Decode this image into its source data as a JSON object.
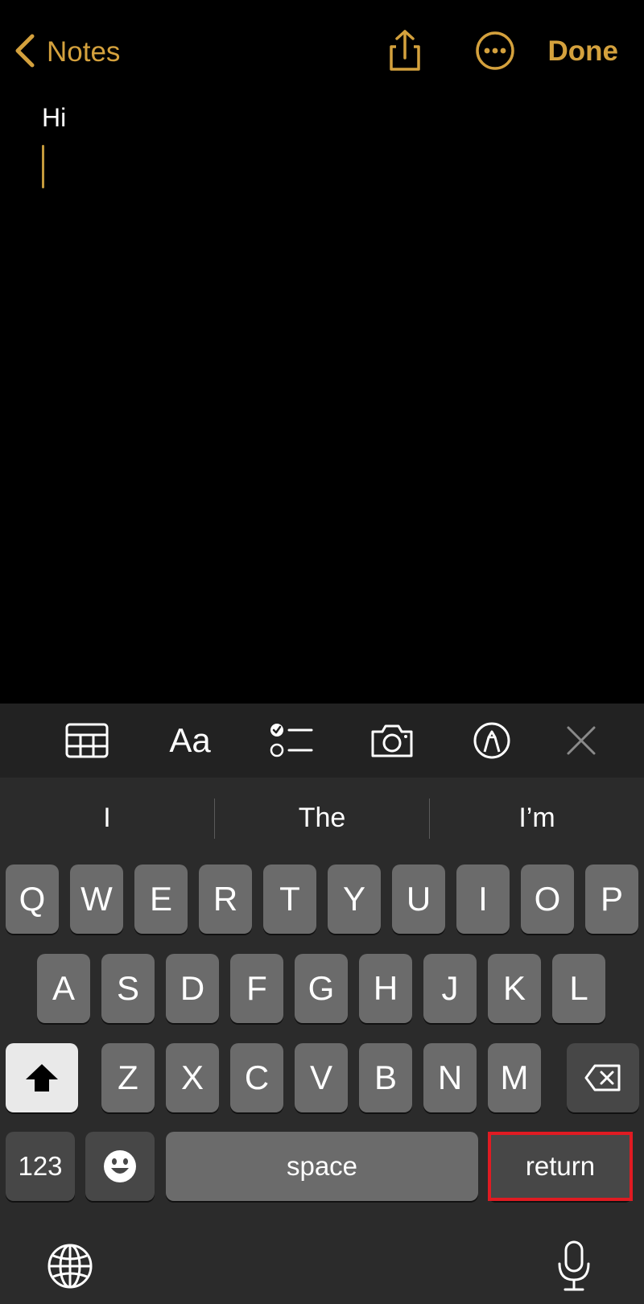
{
  "nav": {
    "back_label": "Notes",
    "done_label": "Done",
    "icons": [
      "chevron-left-icon",
      "share-icon",
      "ellipsis-circle-icon"
    ]
  },
  "note": {
    "text": "Hi"
  },
  "toolbar": {
    "format_label": "Aa",
    "icons": [
      "table-icon",
      "checklist-icon",
      "camera-icon",
      "markup-pen-icon",
      "close-icon"
    ]
  },
  "keyboard": {
    "suggestions": [
      "I",
      "The",
      "I’m"
    ],
    "row1": [
      "Q",
      "W",
      "E",
      "R",
      "T",
      "Y",
      "U",
      "I",
      "O",
      "P"
    ],
    "row2": [
      "A",
      "S",
      "D",
      "F",
      "G",
      "H",
      "J",
      "K",
      "L"
    ],
    "row3": [
      "Z",
      "X",
      "C",
      "V",
      "B",
      "N",
      "M"
    ],
    "numbers_label": "123",
    "space_label": "space",
    "return_label": "return",
    "icons": [
      "shift-icon",
      "backspace-icon",
      "emoji-icon",
      "globe-icon",
      "microphone-icon"
    ]
  },
  "colors": {
    "accent": "#d4a13d",
    "background": "#000000",
    "keyboard_bg": "#2b2b2b",
    "key_bg": "#6b6b6b",
    "highlight": "#e01b22"
  }
}
